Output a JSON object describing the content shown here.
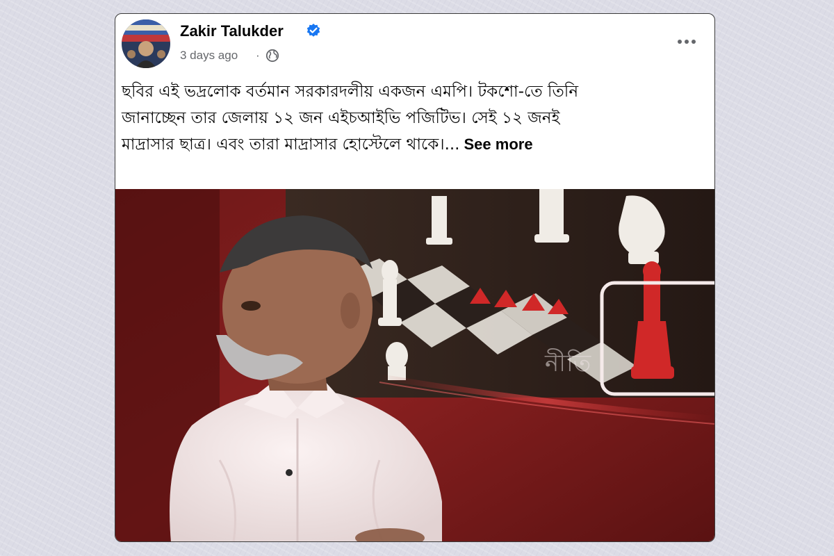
{
  "post": {
    "author": "Zakir Talukder",
    "verified_icon": "verified-badge-icon",
    "time": "3 days ago",
    "separator": "·",
    "audience_icon": "globe-icon",
    "more_icon": "more-options-icon",
    "text_lines": [
      "ছবির এই ভদ্রলোক বর্তমান সরকারদলীয় একজন এমপি। টকশো-তে তিনি",
      "জানাচ্ছেন তার জেলায় ১২ জন এইচআইভি পজিটিভ। সেই ১২ জনই",
      "মাদ্রাসার ছাত্র। এবং তারা মাদ্রাসার হোস্টেলে থাকে।..."
    ],
    "see_more": "See more",
    "video_watermark": "নীতি"
  },
  "colors": {
    "background": "#dcdce6",
    "verified_blue": "#1877f2",
    "secondary_text": "#65676b",
    "studio_red": "#8a1a1a"
  }
}
